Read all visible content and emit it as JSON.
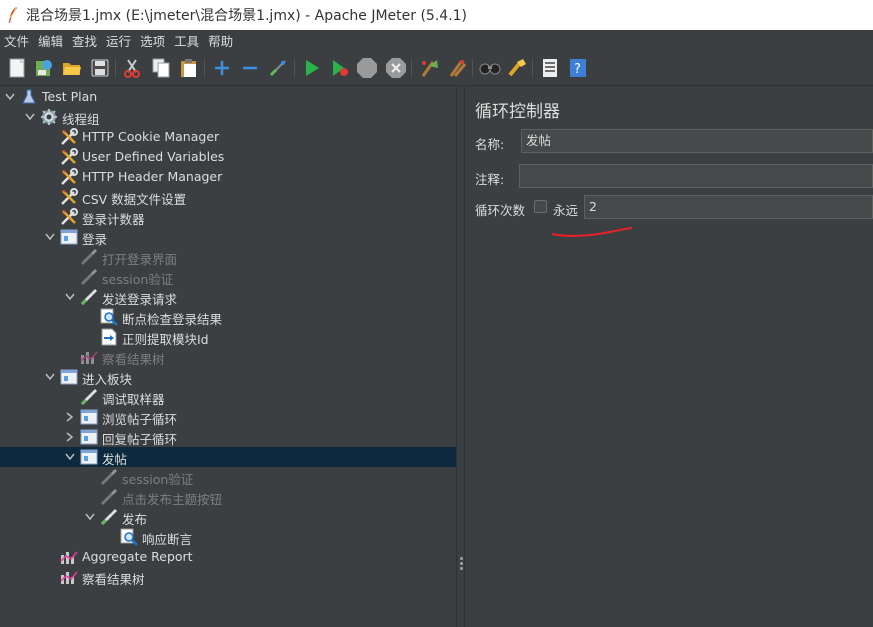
{
  "window": {
    "title": "混合场景1.jmx (E:\\jmeter\\混合场景1.jmx) - Apache JMeter (5.4.1)"
  },
  "menu": [
    "文件",
    "编辑",
    "查找",
    "运行",
    "选项",
    "工具",
    "帮助"
  ],
  "toolbar": [
    "new-icon",
    "templates-icon",
    "open-icon",
    "save-icon",
    "cut-icon",
    "copy-icon",
    "paste-icon",
    "expand-icon",
    "collapse-icon",
    "toggle-icon",
    "start-icon",
    "start-no-pause-icon",
    "stop-icon",
    "shutdown-icon",
    "clear-icon",
    "clear-all-icon",
    "search-icon",
    "reset-search-icon",
    "function-helper-icon",
    "help-icon"
  ],
  "tree": [
    {
      "label": "Test Plan",
      "icon": "flask",
      "expander": "down",
      "enabled": true
    },
    {
      "label": "线程组",
      "icon": "gear",
      "expander": "down",
      "enabled": true
    },
    {
      "label": "HTTP Cookie Manager",
      "icon": "wrench",
      "expander": "",
      "enabled": true
    },
    {
      "label": "User Defined Variables",
      "icon": "wrench",
      "expander": "",
      "enabled": true
    },
    {
      "label": "HTTP Header Manager",
      "icon": "wrench",
      "expander": "",
      "enabled": true
    },
    {
      "label": "CSV 数据文件设置",
      "icon": "wrench",
      "expander": "",
      "enabled": true
    },
    {
      "label": "登录计数器",
      "icon": "wrench",
      "expander": "",
      "enabled": true
    },
    {
      "label": "登录",
      "icon": "controller",
      "expander": "down",
      "enabled": true
    },
    {
      "label": "打开登录界面",
      "icon": "pipette",
      "expander": "",
      "enabled": false
    },
    {
      "label": "session验证",
      "icon": "pipette",
      "expander": "",
      "enabled": false
    },
    {
      "label": "发送登录请求",
      "icon": "pipette",
      "expander": "down",
      "enabled": true
    },
    {
      "label": "断点检查登录结果",
      "icon": "magnifier",
      "expander": "",
      "enabled": true
    },
    {
      "label": "正则提取模块Id",
      "icon": "extractor",
      "expander": "",
      "enabled": true
    },
    {
      "label": "察看结果树",
      "icon": "listener",
      "expander": "",
      "enabled": false
    },
    {
      "label": "进入板块",
      "icon": "controller",
      "expander": "down",
      "enabled": true
    },
    {
      "label": "调试取样器",
      "icon": "pipette",
      "expander": "",
      "enabled": true
    },
    {
      "label": "浏览帖子循环",
      "icon": "controller",
      "expander": "right",
      "enabled": true
    },
    {
      "label": "回复帖子循环",
      "icon": "controller",
      "expander": "right",
      "enabled": true
    },
    {
      "label": "发帖",
      "icon": "controller",
      "expander": "down",
      "enabled": true,
      "selected": true
    },
    {
      "label": "session验证",
      "icon": "pipette",
      "expander": "",
      "enabled": false
    },
    {
      "label": "点击发布主题按钮",
      "icon": "pipette",
      "expander": "",
      "enabled": false
    },
    {
      "label": "发布",
      "icon": "pipette",
      "expander": "down",
      "enabled": true
    },
    {
      "label": "响应断言",
      "icon": "magnifier",
      "expander": "",
      "enabled": true
    },
    {
      "label": "Aggregate Report",
      "icon": "listener",
      "expander": "",
      "enabled": true
    },
    {
      "label": "察看结果树",
      "icon": "listener",
      "expander": "",
      "enabled": true
    }
  ],
  "panel": {
    "title": "循环控制器",
    "name_label": "名称:",
    "name_value": "发帖",
    "comment_label": "注释:",
    "comment_value": "",
    "loop_label": "循环次数",
    "forever_label": "永远",
    "forever_checked": false,
    "loop_value": "2",
    "annotation_color": "#e8202a"
  },
  "colors": {
    "bg": "#3c3f41",
    "text": "#dcdcdc",
    "disabled": "#7e7e7e",
    "selection": "#0d293e"
  }
}
